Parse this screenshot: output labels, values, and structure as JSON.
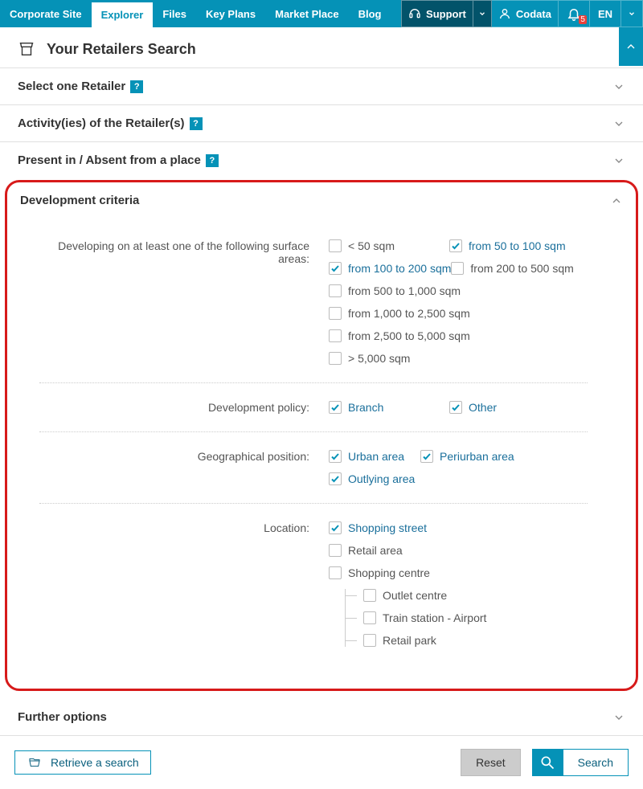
{
  "nav": {
    "items": [
      "Corporate Site",
      "Explorer",
      "Files",
      "Key Plans",
      "Market Place",
      "Blog"
    ],
    "active_index": 1,
    "support": "Support",
    "user": "Codata",
    "lang": "EN",
    "notifications": "5"
  },
  "page_title": "Your Retailers Search",
  "sections": {
    "retailer": "Select one Retailer",
    "activity": "Activity(ies) of the Retailer(s)",
    "presence": "Present in / Absent from a place",
    "development": "Development criteria",
    "further": "Further options"
  },
  "dev": {
    "surface": {
      "label": "Developing on at least one of the following surface areas:",
      "opts": [
        {
          "label": "< 50 sqm",
          "checked": false
        },
        {
          "label": "from 50 to 100 sqm",
          "checked": true
        },
        {
          "label": "from 100 to 200 sqm",
          "checked": true
        },
        {
          "label": "from 200 to 500 sqm",
          "checked": false
        },
        {
          "label": "from 500 to 1,000 sqm",
          "checked": false
        },
        {
          "label": "from 1,000 to 2,500 sqm",
          "checked": false
        },
        {
          "label": "from 2,500 to 5,000 sqm",
          "checked": false
        },
        {
          "label": "> 5,000 sqm",
          "checked": false
        }
      ]
    },
    "policy": {
      "label": "Development policy:",
      "opts": [
        {
          "label": "Branch",
          "checked": true
        },
        {
          "label": "Other",
          "checked": true
        }
      ]
    },
    "geo": {
      "label": "Geographical position:",
      "opts": [
        {
          "label": "Urban area",
          "checked": true
        },
        {
          "label": "Periurban area",
          "checked": true
        },
        {
          "label": "Outlying area",
          "checked": true
        }
      ]
    },
    "location": {
      "label": "Location:",
      "items": [
        {
          "label": "Shopping street",
          "checked": true,
          "children": []
        },
        {
          "label": "Retail area",
          "checked": false,
          "children": []
        },
        {
          "label": "Shopping centre",
          "checked": false,
          "children": [
            {
              "label": "Outlet centre",
              "checked": false
            },
            {
              "label": "Train station - Airport",
              "checked": false
            },
            {
              "label": "Retail park",
              "checked": false
            }
          ]
        }
      ]
    }
  },
  "footer": {
    "retrieve": "Retrieve a search",
    "reset": "Reset",
    "search": "Search"
  },
  "help_symbol": "?"
}
